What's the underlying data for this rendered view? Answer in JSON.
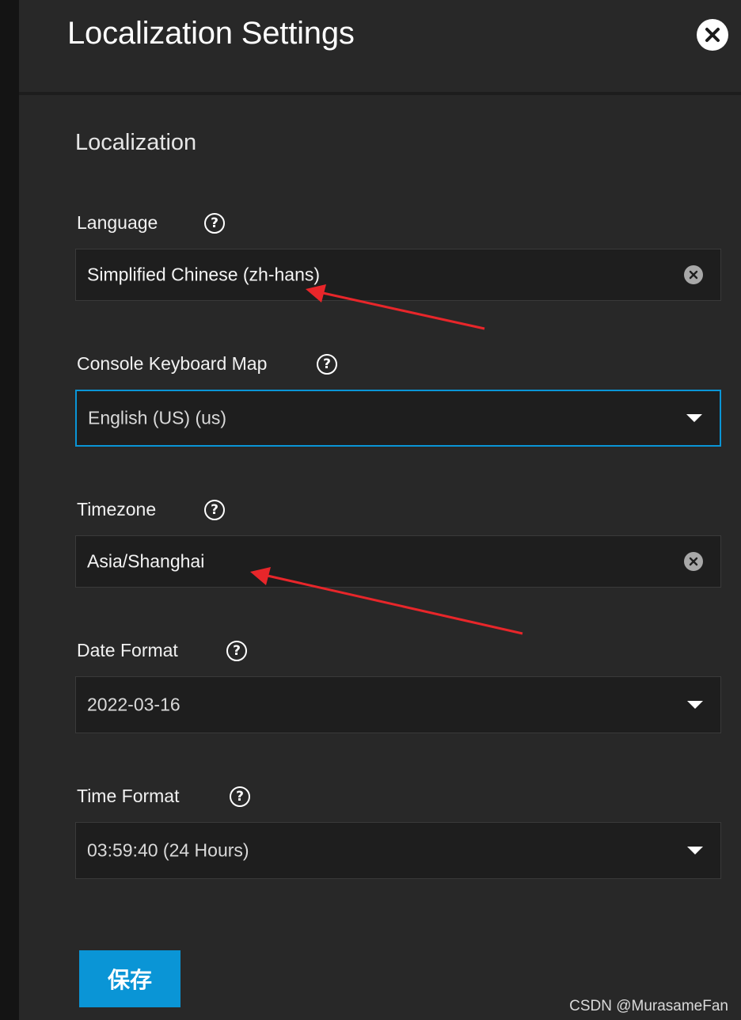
{
  "dialog": {
    "title": "Localization Settings",
    "close_icon": "close-icon"
  },
  "section": {
    "heading": "Localization"
  },
  "fields": {
    "language": {
      "label": "Language",
      "value": "Simplified Chinese (zh-hans)",
      "help_icon": "help-icon",
      "clear_icon": "clear-icon"
    },
    "keyboard_map": {
      "label": "Console Keyboard Map",
      "value": "English (US) (us)",
      "help_icon": "help-icon",
      "dropdown_icon": "chevron-down-icon"
    },
    "timezone": {
      "label": "Timezone",
      "value": "Asia/Shanghai",
      "help_icon": "help-icon",
      "clear_icon": "clear-icon"
    },
    "date_format": {
      "label": "Date Format",
      "value": "2022-03-16",
      "help_icon": "help-icon",
      "dropdown_icon": "chevron-down-icon"
    },
    "time_format": {
      "label": "Time Format",
      "value": "03:59:40 (24 Hours)",
      "help_icon": "help-icon",
      "dropdown_icon": "chevron-down-icon"
    }
  },
  "actions": {
    "save_label": "保存"
  },
  "watermark": "CSDN @MurasameFan",
  "colors": {
    "accent": "#0a95d6",
    "panel_bg": "#282828",
    "field_bg": "#1e1e1e",
    "annotation_arrow": "#e8262a"
  }
}
